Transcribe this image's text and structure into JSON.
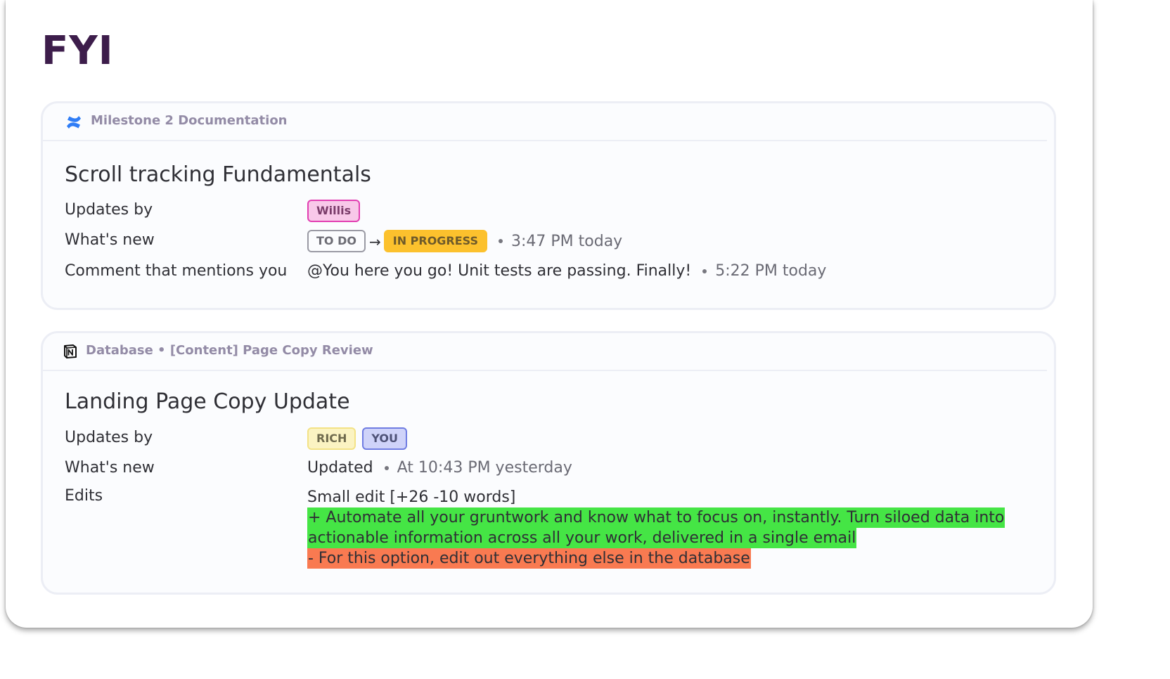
{
  "page": {
    "title": "FYI"
  },
  "cards": [
    {
      "source_icon": "confluence-icon",
      "source": "Milestone 2 Documentation",
      "title": "Scroll tracking Fundamentals",
      "rows": {
        "updates_by": {
          "label": "Updates by",
          "users": [
            "Willis"
          ]
        },
        "whats_new": {
          "label": "What's new",
          "from_status": "TO DO",
          "to_status": "IN PROGRESS",
          "time": "3:47 PM today"
        },
        "comment": {
          "label": "Comment that mentions you",
          "text": "@You here you go! Unit tests are passing. Finally!",
          "time": "5:22 PM today"
        }
      }
    },
    {
      "source_icon": "notion-icon",
      "source": "Database • [Content] Page Copy Review",
      "title": "Landing Page Copy Update",
      "rows": {
        "updates_by": {
          "label": "Updates by",
          "users": [
            "RICH",
            "YOU"
          ]
        },
        "whats_new": {
          "label": "What's new",
          "text": "Updated",
          "time": "At 10:43 PM yesterday"
        },
        "edits": {
          "label": "Edits",
          "summary": "Small edit [+26 -10 words]",
          "added_line_1": "+ Automate all your gruntwork and know what to focus on, instantly. Turn siloed data into",
          "added_line_2": "actionable information across all your work, delivered in a single email",
          "removed_line_1": "- For this option, edit out everything else in the database"
        }
      }
    }
  ],
  "colors": {
    "title": "#3d1d4b",
    "added": "#45e545",
    "removed": "#f97a51",
    "in_progress": "#fcc12d"
  }
}
